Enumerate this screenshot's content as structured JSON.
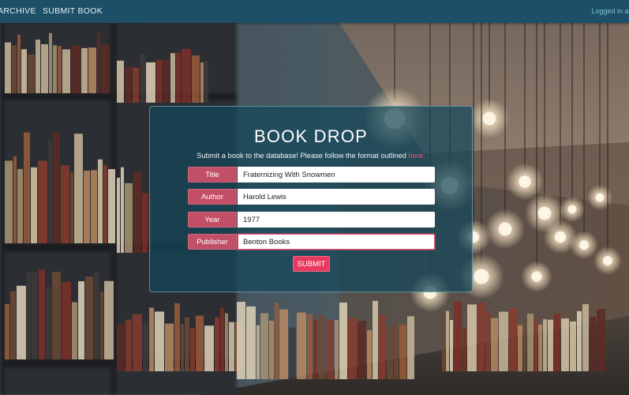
{
  "navbar": {
    "archive_label": "ARCHIVE",
    "submit_label": "SUBMIT BOOK",
    "login_text": "Logged in as"
  },
  "form": {
    "title": "BOOK DROP",
    "subtitle": "Submit a book to the database! Please follow the format outlined",
    "subtitle_link": "here.",
    "fields": {
      "title": {
        "label": "Title",
        "value": "Fraternizing With Snowmen"
      },
      "author": {
        "label": "Author",
        "value": "Harold Lewis"
      },
      "year": {
        "label": "Year",
        "value": "1977"
      },
      "publisher": {
        "label": "Publisher",
        "value": "Benton Books"
      }
    },
    "submit_label": "SUBMIT"
  },
  "colors": {
    "navbar": "#1d5068",
    "accent": "#e8395f",
    "label_bg": "#c24f66",
    "panel": "#14465a"
  }
}
